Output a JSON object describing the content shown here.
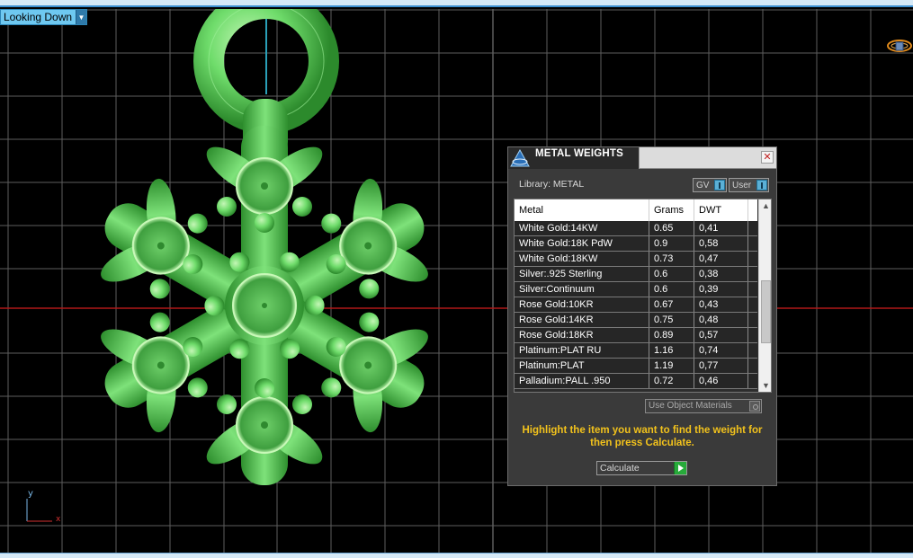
{
  "viewport": {
    "view_menu_label": "Looking Down",
    "axis_y_label": "y",
    "axis_x_label": "x",
    "colors": {
      "background": "#000000",
      "grid": "#6e6e6e",
      "model": "#6fdc6b",
      "x_axis": "#b01818",
      "y_axis": "#2aa0b8"
    }
  },
  "panel": {
    "title": "METAL WEIGHTS",
    "library_label": "Library: METAL",
    "toggles": [
      {
        "label": "GV"
      },
      {
        "label": "User"
      }
    ],
    "columns": [
      "Metal",
      "Grams",
      "DWT"
    ],
    "rows": [
      {
        "metal": "White Gold:14KW",
        "grams": "0.65",
        "dwt": "0,41"
      },
      {
        "metal": "White Gold:18K PdW",
        "grams": "0.9",
        "dwt": "0,58"
      },
      {
        "metal": "White Gold:18KW",
        "grams": "0.73",
        "dwt": "0,47"
      },
      {
        "metal": "Silver:.925 Sterling",
        "grams": "0.6",
        "dwt": "0,38"
      },
      {
        "metal": "Silver:Continuum",
        "grams": "0.6",
        "dwt": "0,39"
      },
      {
        "metal": "Rose Gold:10KR",
        "grams": "0.67",
        "dwt": "0,43"
      },
      {
        "metal": "Rose Gold:14KR",
        "grams": "0.75",
        "dwt": "0,48"
      },
      {
        "metal": "Rose Gold:18KR",
        "grams": "0.89",
        "dwt": "0,57"
      },
      {
        "metal": "Platinum:PLAT RU",
        "grams": "1.16",
        "dwt": "0,74"
      },
      {
        "metal": "Platinum:PLAT",
        "grams": "1.19",
        "dwt": "0,77"
      },
      {
        "metal": "Palladium:PALL .950",
        "grams": "0.72",
        "dwt": "0,46"
      }
    ],
    "use_object_materials_label": "Use Object Materials",
    "hint": "Highlight the item you want to find the weight for then press Calculate.",
    "calculate_label": "Calculate",
    "colors": {
      "hint": "#f2c21c",
      "go_button": "#27aa3a",
      "toggle_indicator": "#5bb0d6"
    }
  }
}
